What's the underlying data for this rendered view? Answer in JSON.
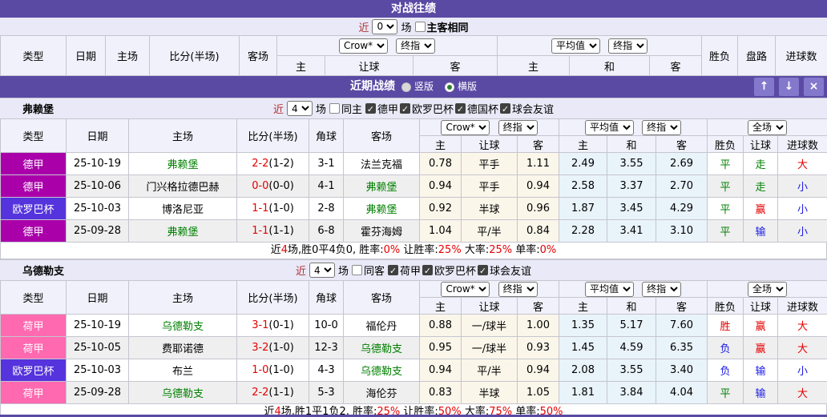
{
  "palette": {
    "bar_purple": "#5a4aa4",
    "button_purple": "#8478cc",
    "green": "#008000",
    "red": "#e60000",
    "blue": "#1a1ae6",
    "badge_bundesliga": "#aa00aa",
    "badge_europa": "#5533dd",
    "badge_eredivisie": "#ff69b0",
    "crow_cell_bg": "#fbf6ea",
    "avg_cell_bg": "#e9f3fa"
  },
  "icons": {
    "up_icon": "↑",
    "down_icon": "↓",
    "close_icon": "×",
    "check_icon": "✓",
    "dropdown_arrow": "▼"
  },
  "h2h": {
    "title": "对战往绩",
    "filter": {
      "near": "近",
      "count": "0",
      "matches": "场",
      "same_label": "主客相同"
    },
    "header": {
      "cols": [
        "类型",
        "日期",
        "主场",
        "比分(半场)",
        "客场"
      ],
      "crow": "Crow*",
      "fin": "终指",
      "avg": "平均值",
      "fin2": "终指",
      "sub1": [
        "主",
        "让球",
        "客"
      ],
      "sub2": [
        "主",
        "和",
        "客"
      ],
      "tail": [
        "胜负",
        "盘路",
        "进球数"
      ]
    }
  },
  "recent": {
    "title": "近期战绩",
    "radio_vertical": "竖版",
    "radio_horizontal": "横版"
  },
  "sec_header": {
    "cols": [
      "类型",
      "日期",
      "主场",
      "比分(半场)",
      "角球",
      "客场"
    ],
    "crow": "Crow*",
    "fin": "终指",
    "avg": "平均值",
    "fin2": "终指",
    "full": "全场",
    "sub": [
      "主",
      "让球",
      "客",
      "主",
      "和",
      "客",
      "胜负",
      "让球",
      "进球数"
    ]
  },
  "sections": [
    {
      "filter": {
        "team": "弗赖堡",
        "near": "近",
        "count": "4",
        "matches": "场",
        "same_label": "同主",
        "leagues": [
          "德甲",
          "欧罗巴杯",
          "德国杯",
          "球会友谊"
        ]
      },
      "rows": [
        {
          "league": "德甲",
          "league_color": "badge_bundesliga",
          "date": "25-10-19",
          "home": "弗赖堡",
          "home_hl": true,
          "score": "2-2",
          "half": "(1-2)",
          "corner": "3-1",
          "away": "法兰克福",
          "away_hl": false,
          "odds": [
            "0.78",
            "平手",
            "1.11"
          ],
          "avg": [
            "2.49",
            "3.55",
            "2.69"
          ],
          "result": {
            "t": "平",
            "c": "green"
          },
          "handicap": {
            "t": "走",
            "c": "green"
          },
          "goals": {
            "t": "大",
            "c": "red"
          }
        },
        {
          "league": "德甲",
          "league_color": "badge_bundesliga",
          "date": "25-10-06",
          "home": "门兴格拉德巴赫",
          "home_hl": false,
          "score": "0-0",
          "half": "(0-0)",
          "corner": "4-1",
          "away": "弗赖堡",
          "away_hl": true,
          "odds": [
            "0.94",
            "平手",
            "0.94"
          ],
          "avg": [
            "2.58",
            "3.37",
            "2.70"
          ],
          "result": {
            "t": "平",
            "c": "green"
          },
          "handicap": {
            "t": "走",
            "c": "green"
          },
          "goals": {
            "t": "小",
            "c": "blue"
          }
        },
        {
          "league": "欧罗巴杯",
          "league_color": "badge_europa",
          "date": "25-10-03",
          "home": "博洛尼亚",
          "home_hl": false,
          "score": "1-1",
          "half": "(1-0)",
          "corner": "2-8",
          "away": "弗赖堡",
          "away_hl": true,
          "odds": [
            "0.92",
            "半球",
            "0.96"
          ],
          "avg": [
            "1.87",
            "3.45",
            "4.29"
          ],
          "result": {
            "t": "平",
            "c": "green"
          },
          "handicap": {
            "t": "赢",
            "c": "red"
          },
          "goals": {
            "t": "小",
            "c": "blue"
          }
        },
        {
          "league": "德甲",
          "league_color": "badge_bundesliga",
          "date": "25-09-28",
          "home": "弗赖堡",
          "home_hl": true,
          "score": "1-1",
          "half": "(1-1)",
          "corner": "6-8",
          "away": "霍芬海姆",
          "away_hl": false,
          "odds": [
            "1.04",
            "平/半",
            "0.84"
          ],
          "avg": [
            "2.28",
            "3.41",
            "3.10"
          ],
          "result": {
            "t": "平",
            "c": "green"
          },
          "handicap": {
            "t": "输",
            "c": "blue"
          },
          "goals": {
            "t": "小",
            "c": "blue"
          }
        }
      ],
      "summary": [
        {
          "t": "近"
        },
        {
          "t": "4",
          "red": true
        },
        {
          "t": "场,胜0平4负0, 胜率:"
        },
        {
          "t": "0%",
          "red": true
        },
        {
          "t": " 让胜率:"
        },
        {
          "t": "25%",
          "red": true
        },
        {
          "t": " 大率:"
        },
        {
          "t": "25%",
          "red": true
        },
        {
          "t": " 单率:"
        },
        {
          "t": "0%",
          "red": true
        }
      ]
    },
    {
      "filter": {
        "team": "乌德勒支",
        "near": "近",
        "count": "4",
        "matches": "场",
        "same_label": "同客",
        "leagues": [
          "荷甲",
          "欧罗巴杯",
          "球会友谊"
        ]
      },
      "rows": [
        {
          "league": "荷甲",
          "league_color": "badge_eredivisie",
          "date": "25-10-19",
          "home": "乌德勒支",
          "home_hl": true,
          "score": "3-1",
          "half": "(0-1)",
          "corner": "10-0",
          "away": "福伦丹",
          "away_hl": false,
          "odds": [
            "0.88",
            "一/球半",
            "1.00"
          ],
          "avg": [
            "1.35",
            "5.17",
            "7.60"
          ],
          "result": {
            "t": "胜",
            "c": "red"
          },
          "handicap": {
            "t": "赢",
            "c": "red"
          },
          "goals": {
            "t": "大",
            "c": "red"
          }
        },
        {
          "league": "荷甲",
          "league_color": "badge_eredivisie",
          "date": "25-10-05",
          "home": "费耶诺德",
          "home_hl": false,
          "score": "3-2",
          "half": "(1-0)",
          "corner": "12-3",
          "away": "乌德勒支",
          "away_hl": true,
          "odds": [
            "0.95",
            "一/球半",
            "0.93"
          ],
          "avg": [
            "1.45",
            "4.59",
            "6.35"
          ],
          "result": {
            "t": "负",
            "c": "blue"
          },
          "handicap": {
            "t": "赢",
            "c": "red"
          },
          "goals": {
            "t": "大",
            "c": "red"
          }
        },
        {
          "league": "欧罗巴杯",
          "league_color": "badge_europa",
          "date": "25-10-03",
          "home": "布兰",
          "home_hl": false,
          "score": "1-0",
          "half": "(1-0)",
          "corner": "4-3",
          "away": "乌德勒支",
          "away_hl": true,
          "odds": [
            "0.94",
            "平/半",
            "0.94"
          ],
          "avg": [
            "2.08",
            "3.55",
            "3.40"
          ],
          "result": {
            "t": "负",
            "c": "blue"
          },
          "handicap": {
            "t": "输",
            "c": "blue"
          },
          "goals": {
            "t": "小",
            "c": "blue"
          }
        },
        {
          "league": "荷甲",
          "league_color": "badge_eredivisie",
          "date": "25-09-28",
          "home": "乌德勒支",
          "home_hl": true,
          "score": "2-2",
          "half": "(1-1)",
          "corner": "5-3",
          "away": "海伦芬",
          "away_hl": false,
          "odds": [
            "0.83",
            "半球",
            "1.05"
          ],
          "avg": [
            "1.81",
            "3.84",
            "4.04"
          ],
          "result": {
            "t": "平",
            "c": "green"
          },
          "handicap": {
            "t": "输",
            "c": "blue"
          },
          "goals": {
            "t": "大",
            "c": "red"
          }
        }
      ],
      "summary": [
        {
          "t": "近"
        },
        {
          "t": "4",
          "red": true
        },
        {
          "t": "场,胜1平1负2, 胜率:"
        },
        {
          "t": "25%",
          "red": true
        },
        {
          "t": " 让胜率:"
        },
        {
          "t": "50%",
          "red": true
        },
        {
          "t": " 大率:"
        },
        {
          "t": "75%",
          "red": true
        },
        {
          "t": " 单率:"
        },
        {
          "t": "50%",
          "red": true
        }
      ]
    }
  ]
}
